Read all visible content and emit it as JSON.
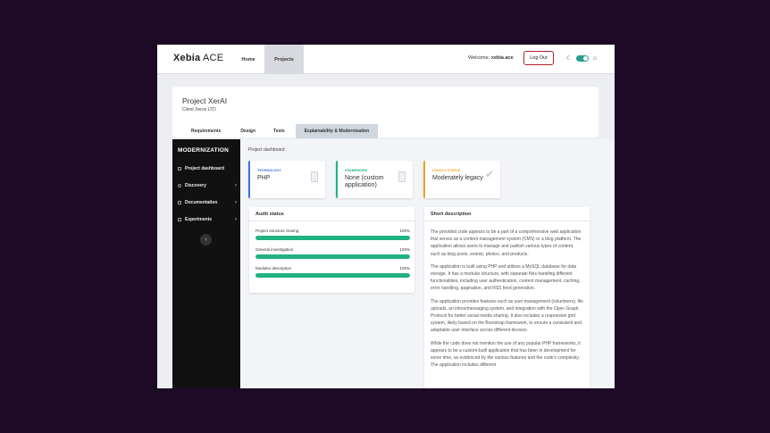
{
  "brand": {
    "logo_main": "Xebia",
    "logo_suffix": " ACE"
  },
  "nav": {
    "home": "Home",
    "projects": "Projects"
  },
  "user": {
    "welcome_prefix": "Welcome, ",
    "username": "xebia.ace",
    "logout": "Log Out"
  },
  "project": {
    "title": "Project XerAI",
    "client": "Client Xerox LTD"
  },
  "tabs": [
    {
      "label": "Requirements"
    },
    {
      "label": "Design"
    },
    {
      "label": "Tests"
    },
    {
      "label": "Explainability & Modernization",
      "active": true
    }
  ],
  "sidebar": {
    "title": "MODERNIZATION",
    "items": [
      {
        "label": "Project dashboard"
      },
      {
        "label": "Discovery"
      },
      {
        "label": "Documentation"
      },
      {
        "label": "Experiments"
      }
    ],
    "collapse_icon": "chevron-left-icon"
  },
  "breadcrumb": "Project dashboard",
  "cards": [
    {
      "label": "Technology",
      "value": "PHP",
      "color": "#3b6fe0"
    },
    {
      "label": "Framework",
      "value": "None (custom application)",
      "color": "#20b27f"
    },
    {
      "label": "Legacy status",
      "value": "Moderately legacy",
      "color": "#f0a020"
    }
  ],
  "audit": {
    "title": "Audit status",
    "rows": [
      {
        "name": "Project structure cloning",
        "percent_label": "100%",
        "percent": 100
      },
      {
        "name": "General investigation",
        "percent_label": "100%",
        "percent": 100
      },
      {
        "name": "Modules description",
        "percent_label": "100%",
        "percent": 100
      }
    ]
  },
  "description": {
    "title": "Short description",
    "paragraphs": [
      "The provided code appears to be a part of a comprehensive web application that serves as a content management system (CMS) or a blog platform. The application allows users to manage and publish various types of content, such as blog posts, events, photos, and products.",
      "The application is built using PHP and utilizes a MySQL database for data storage. It has a modular structure, with separate files handling different functionalities, including user authentication, content management, caching, error handling, pagination, and RSS feed generation.",
      "The application provides features such as user management (volunteers), file uploads, an inbox/messaging system, and integration with the Open Graph Protocol for better social media sharing. It also includes a responsive grid system, likely based on the Bootstrap framework, to ensure a consistent and adaptable user interface across different devices.",
      "While the code does not mention the use of any popular PHP frameworks, it appears to be a custom-built application that has been in development for some time, as evidenced by the various features and the code's complexity. The application includes different"
    ]
  },
  "colors": {
    "accent_green": "#20b27f",
    "logout_border": "#b0202a",
    "toggle": "#2a9d8f"
  }
}
